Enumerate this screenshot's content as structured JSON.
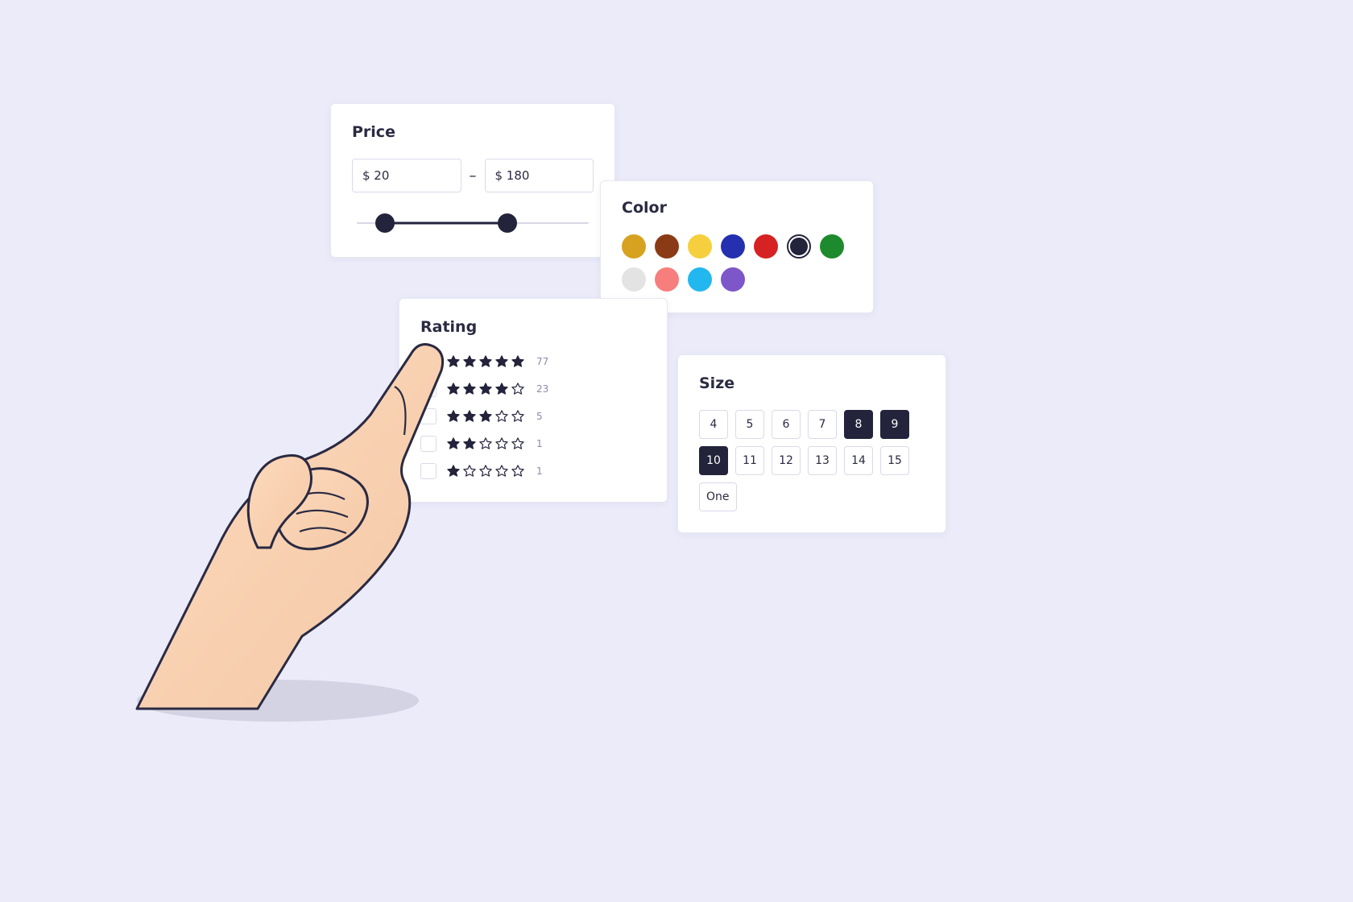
{
  "price": {
    "title": "Price",
    "currency": "$",
    "min": "20",
    "max": "180",
    "min_display": "$ 20",
    "max_display": "$ 180"
  },
  "color": {
    "title": "Color",
    "swatches": [
      {
        "hex": "#d6a21f",
        "selected": false
      },
      {
        "hex": "#8b3a16",
        "selected": false
      },
      {
        "hex": "#f5cf3e",
        "selected": false
      },
      {
        "hex": "#2530b0",
        "selected": false
      },
      {
        "hex": "#d62222",
        "selected": false
      },
      {
        "hex": "#23233b",
        "selected": true
      },
      {
        "hex": "#1e8a2e",
        "selected": false
      },
      {
        "hex": "#e3e3e3",
        "selected": false
      },
      {
        "hex": "#f67e7c",
        "selected": false
      },
      {
        "hex": "#22b8ef",
        "selected": false
      },
      {
        "hex": "#7d56c9",
        "selected": false
      }
    ]
  },
  "rating": {
    "title": "Rating",
    "rows": [
      {
        "stars": 5,
        "count": "77",
        "checked": true
      },
      {
        "stars": 4,
        "count": "23",
        "checked": false
      },
      {
        "stars": 3,
        "count": "5",
        "checked": false
      },
      {
        "stars": 2,
        "count": "1",
        "checked": false
      },
      {
        "stars": 1,
        "count": "1",
        "checked": false
      }
    ]
  },
  "size": {
    "title": "Size",
    "options": [
      {
        "label": "4",
        "selected": false
      },
      {
        "label": "5",
        "selected": false
      },
      {
        "label": "6",
        "selected": false
      },
      {
        "label": "7",
        "selected": false
      },
      {
        "label": "8",
        "selected": true
      },
      {
        "label": "9",
        "selected": true
      },
      {
        "label": "10",
        "selected": true
      },
      {
        "label": "11",
        "selected": false
      },
      {
        "label": "12",
        "selected": false
      },
      {
        "label": "13",
        "selected": false
      },
      {
        "label": "14",
        "selected": false
      },
      {
        "label": "15",
        "selected": false
      },
      {
        "label": "One",
        "selected": false
      }
    ]
  }
}
